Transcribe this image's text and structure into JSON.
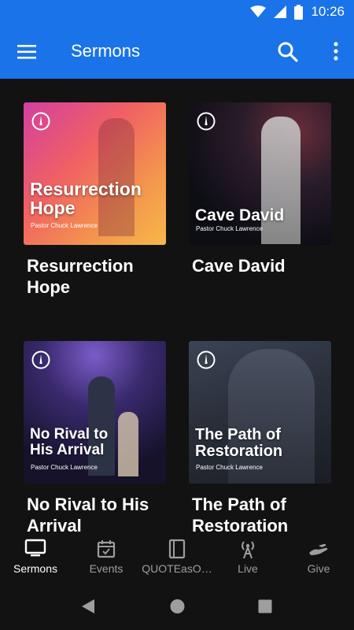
{
  "status_bar": {
    "time": "10:26",
    "icons": [
      "wifi-icon",
      "signal-icon",
      "battery-icon"
    ]
  },
  "app_bar": {
    "title": "Sermons",
    "icons": [
      "menu-icon",
      "search-icon",
      "more-vert-icon"
    ]
  },
  "sermons": [
    {
      "title": "Resurrection Hope",
      "thumb_title": "Resurrection Hope",
      "pastor": "Pastor Chuck Lawrence"
    },
    {
      "title": "Cave David",
      "thumb_title": "Cave David",
      "pastor": "Pastor Chuck Lawrence"
    },
    {
      "title": "No Rival to His Arrival",
      "thumb_title": "No Rival to His Arrival",
      "pastor": "Pastor Chuck Lawrence"
    },
    {
      "title": "The Path of Restoration",
      "thumb_title": "The Path of Restoration",
      "pastor": "Pastor Chuck Lawrence"
    }
  ],
  "bottom_nav": [
    {
      "label": "Sermons",
      "icon": "tv-icon",
      "active": true
    },
    {
      "label": "Events",
      "icon": "calendar-icon",
      "active": false
    },
    {
      "label": "QUOTEasO…",
      "icon": "book-icon",
      "active": false
    },
    {
      "label": "Live",
      "icon": "broadcast-icon",
      "active": false
    },
    {
      "label": "Give",
      "icon": "give-hand-icon",
      "active": false
    }
  ],
  "colors": {
    "app_bar": "#1a73e8",
    "background": "#121212",
    "inactive": "#9e9e9e"
  }
}
